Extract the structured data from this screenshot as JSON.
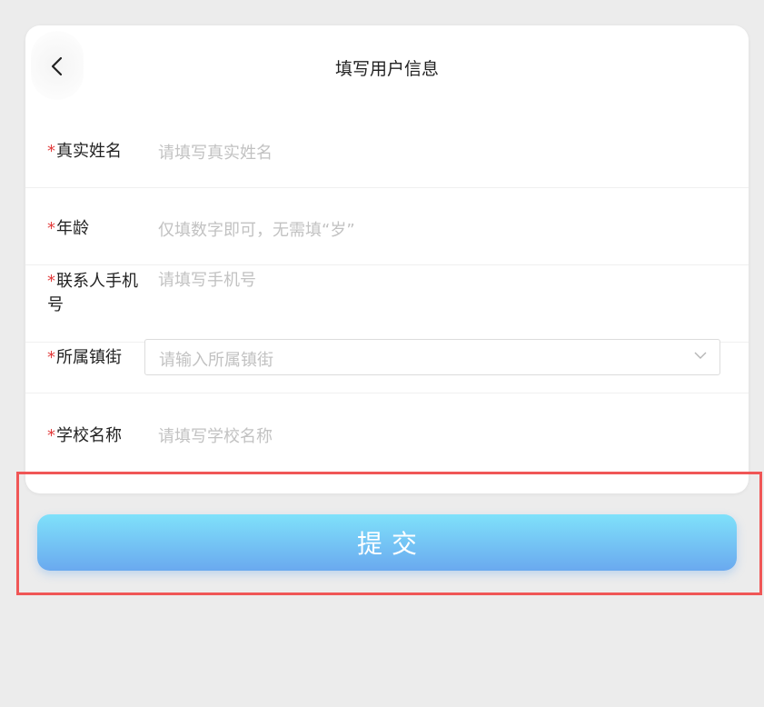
{
  "header": {
    "title": "填写用户信息",
    "back_icon": "chevron-left-icon"
  },
  "form": {
    "required_mark": "*",
    "fields": [
      {
        "label": "真实姓名",
        "placeholder": "请填写真实姓名",
        "value": ""
      },
      {
        "label": "年龄",
        "placeholder": "仅填数字即可，无需填“岁”",
        "value": ""
      },
      {
        "label": "联系人手机号",
        "placeholder": "请填写手机号",
        "value": ""
      },
      {
        "label": "所属镇街",
        "placeholder": "请输入所属镇街",
        "value": ""
      },
      {
        "label": "学校名称",
        "placeholder": "请填写学校名称",
        "value": ""
      }
    ]
  },
  "submit": {
    "label": "提交"
  },
  "colors": {
    "required": "#e23b3b",
    "button_top": "#7fe1fa",
    "button_bottom": "#6aa9ef",
    "highlight": "#f05656",
    "background": "#ececec"
  }
}
